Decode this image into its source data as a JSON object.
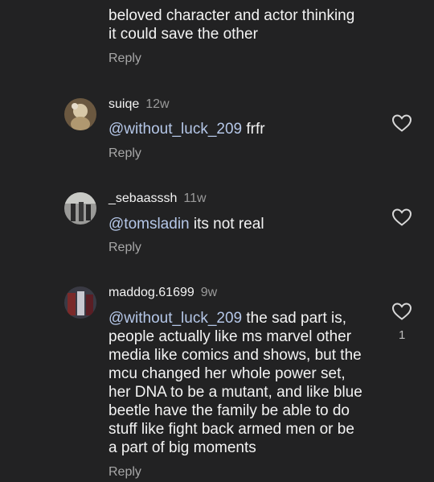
{
  "prev_comment": {
    "text_line1": "beloved character and actor thinking",
    "text_line2": "it could save the other",
    "reply_label": "Reply"
  },
  "comments": [
    {
      "username": "suiqe",
      "time": "12w",
      "mention": "@without_luck_209",
      "text": " frfr",
      "reply_label": "Reply"
    },
    {
      "username": "_sebaasssh",
      "time": "11w",
      "mention": "@tomsladin",
      "text": " its not real",
      "reply_label": "Reply"
    },
    {
      "username": "maddog.61699",
      "time": "9w",
      "mention": "@without_luck_209",
      "lines": [
        " the sad part is,",
        "people actually like ms marvel other",
        "media like comics and shows, but the",
        "mcu changed her whole power set,",
        "her DNA to be a mutant, and like blue",
        "beetle have the family be able to do",
        "stuff like fight back armed men or be",
        "a part of big moments"
      ],
      "like_count": "1",
      "reply_label": "Reply"
    }
  ],
  "icons": {
    "like": "heart-outline-icon"
  },
  "colors": {
    "background": "#222223",
    "mention": "#b5c7e8",
    "muted": "#a7a7a7"
  }
}
